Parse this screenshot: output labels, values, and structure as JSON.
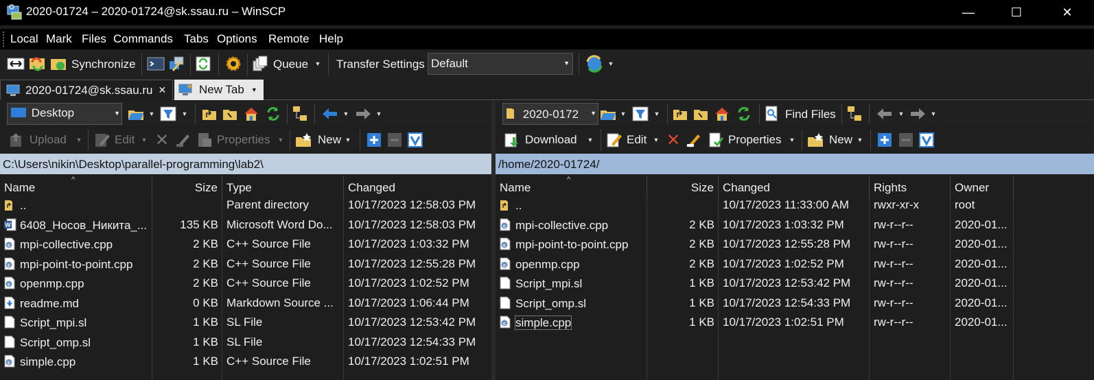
{
  "window": {
    "title": "2020-01724 – 2020-01724@sk.ssau.ru – WinSCP",
    "minimize": "—",
    "maximize": "☐",
    "close": "✕"
  },
  "menu": [
    "Local",
    "Mark",
    "Files",
    "Commands",
    "Tabs",
    "Options",
    "Remote",
    "Help"
  ],
  "toolbar": {
    "synchronize": "Synchronize",
    "queue": "Queue",
    "transfer_settings_label": "Transfer Settings",
    "transfer_settings_value": "Default"
  },
  "tabs": {
    "session": "2020-01724@sk.ssau.ru",
    "close": "✕",
    "new_tab": "New Tab"
  },
  "local": {
    "drive": "Desktop",
    "upload": "Upload",
    "edit": "Edit",
    "properties": "Properties",
    "new": "New",
    "path": "C:\\Users\\nikin\\Desktop\\parallel-programming\\lab2\\",
    "columns": [
      "Name",
      "Size",
      "Type",
      "Changed"
    ],
    "files": [
      {
        "icon": "folder-up",
        "name": "..",
        "size": "",
        "type": "Parent directory",
        "changed": "10/17/2023 12:58:03 PM"
      },
      {
        "icon": "word",
        "name": "6408_Носов_Никита_...",
        "size": "135 KB",
        "type": "Microsoft Word Do...",
        "changed": "10/17/2023 12:58:03 PM"
      },
      {
        "icon": "cpp",
        "name": "mpi-collective.cpp",
        "size": "2 KB",
        "type": "C++ Source File",
        "changed": "10/17/2023 1:03:32 PM"
      },
      {
        "icon": "cpp",
        "name": "mpi-point-to-point.cpp",
        "size": "2 KB",
        "type": "C++ Source File",
        "changed": "10/17/2023 12:55:28 PM"
      },
      {
        "icon": "cpp",
        "name": "openmp.cpp",
        "size": "2 KB",
        "type": "C++ Source File",
        "changed": "10/17/2023 1:02:52 PM"
      },
      {
        "icon": "markdown",
        "name": "readme.md",
        "size": "0 KB",
        "type": "Markdown Source ...",
        "changed": "10/17/2023 1:06:44 PM"
      },
      {
        "icon": "file",
        "name": "Script_mpi.sl",
        "size": "1 KB",
        "type": "SL File",
        "changed": "10/17/2023 12:53:42 PM"
      },
      {
        "icon": "file",
        "name": "Script_omp.sl",
        "size": "1 KB",
        "type": "SL File",
        "changed": "10/17/2023 12:54:33 PM"
      },
      {
        "icon": "cpp",
        "name": "simple.cpp",
        "size": "1 KB",
        "type": "C++ Source File",
        "changed": "10/17/2023 1:02:51 PM"
      }
    ]
  },
  "remote": {
    "dir": "2020-0172",
    "find_files": "Find Files",
    "download": "Download",
    "edit": "Edit",
    "properties": "Properties",
    "new": "New",
    "path": "/home/2020-01724/",
    "columns": [
      "Name",
      "Size",
      "Changed",
      "Rights",
      "Owner"
    ],
    "files": [
      {
        "icon": "folder-up",
        "name": "..",
        "size": "",
        "changed": "10/17/2023 11:33:00 AM",
        "rights": "rwxr-xr-x",
        "owner": "root"
      },
      {
        "icon": "cpp",
        "name": "mpi-collective.cpp",
        "size": "2 KB",
        "changed": "10/17/2023 1:03:32 PM",
        "rights": "rw-r--r--",
        "owner": "2020-01..."
      },
      {
        "icon": "cpp",
        "name": "mpi-point-to-point.cpp",
        "size": "2 KB",
        "changed": "10/17/2023 12:55:28 PM",
        "rights": "rw-r--r--",
        "owner": "2020-01..."
      },
      {
        "icon": "cpp",
        "name": "openmp.cpp",
        "size": "2 KB",
        "changed": "10/17/2023 1:02:52 PM",
        "rights": "rw-r--r--",
        "owner": "2020-01..."
      },
      {
        "icon": "file",
        "name": "Script_mpi.sl",
        "size": "1 KB",
        "changed": "10/17/2023 12:53:42 PM",
        "rights": "rw-r--r--",
        "owner": "2020-01..."
      },
      {
        "icon": "file",
        "name": "Script_omp.sl",
        "size": "1 KB",
        "changed": "10/17/2023 12:54:33 PM",
        "rights": "rw-r--r--",
        "owner": "2020-01..."
      },
      {
        "icon": "cpp",
        "name": "simple.cpp",
        "size": "1 KB",
        "changed": "10/17/2023 1:02:51 PM",
        "rights": "rw-r--r--",
        "owner": "2020-01..."
      }
    ]
  },
  "colors": {
    "local_path_bg": "#bfcfe0",
    "remote_path_bg": "#9db8d8",
    "folder": "#e8c25a",
    "accent_blue": "#2f7ed8",
    "green": "#3cb043",
    "red": "#e04a2a"
  }
}
